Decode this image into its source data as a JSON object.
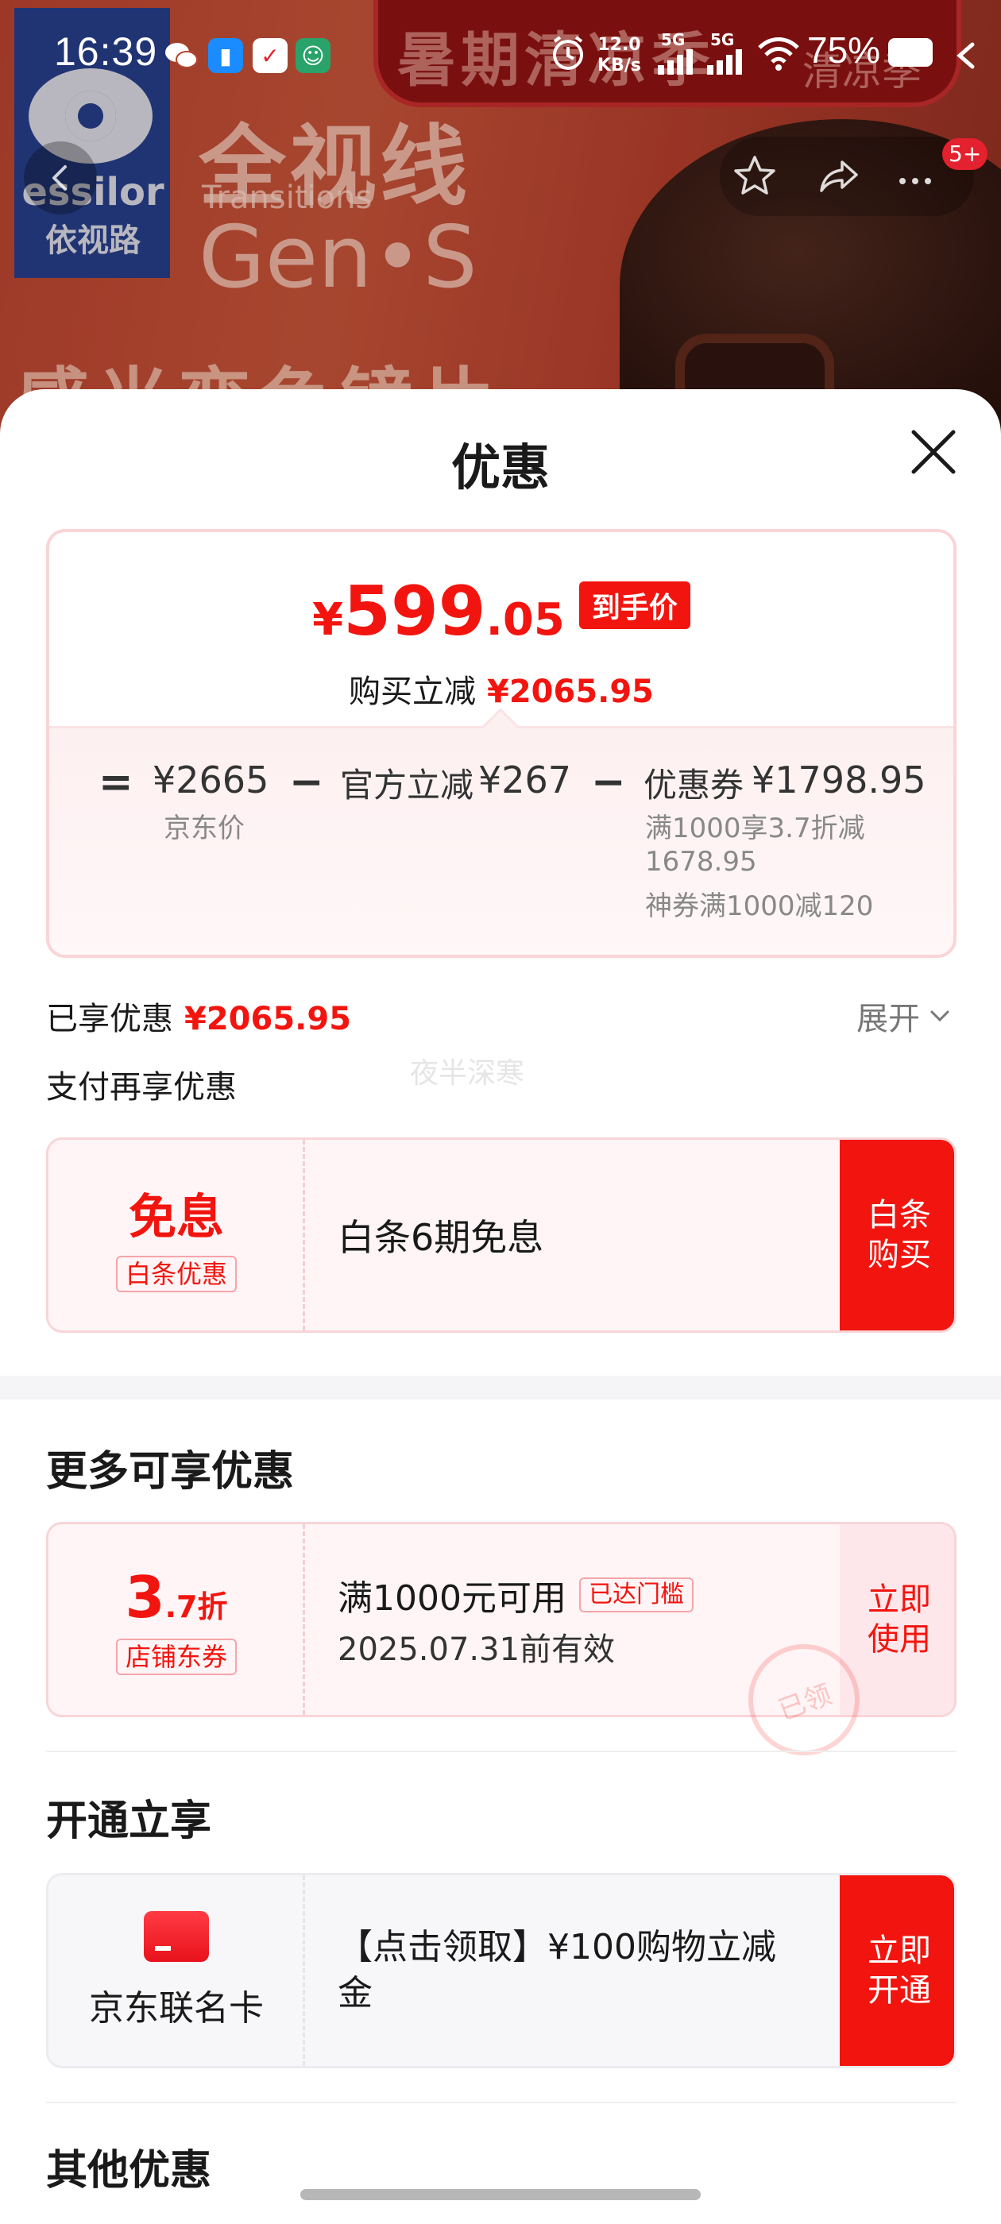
{
  "status_bar": {
    "time": "16:39",
    "net_speed_value": "12.0",
    "net_speed_unit": "KB/s",
    "signal_1": "5G",
    "signal_2": "5G",
    "battery": "75%"
  },
  "hero": {
    "brand_en": "essilor",
    "brand_cn": "依视路",
    "headline_cn": "全视线",
    "headline_en": "Transitions",
    "product_name": "Gen•S",
    "slogan": "感光变色镜片",
    "promo_banner": "暑期清凉季",
    "promo_badge": "清凉季",
    "nav_badge": "5+"
  },
  "sheet": {
    "title": "优惠"
  },
  "price_card": {
    "currency": "¥",
    "price_integer": "599",
    "price_decimal": ".05",
    "price_tag": "到手价",
    "saving_label": "购买立减",
    "saving_amount": "¥2065.95",
    "equals": "=",
    "minus": "−",
    "jd_price": "¥2665",
    "jd_price_label": "京东价",
    "official_label": "官方立减",
    "official_amount": "¥267",
    "coupon_label": "优惠券",
    "coupon_amount": "¥1798.95",
    "coupon_detail_1": "满1000享3.7折减",
    "coupon_detail_2": "1678.95",
    "coupon_detail_3": "神券满1000减120"
  },
  "summary": {
    "enjoyed_label": "已享优惠",
    "enjoyed_amount": "¥2065.95",
    "expand_label": "展开",
    "pay_more_label": "支付再享优惠",
    "watermark": "夜半深寒"
  },
  "baitiao_offer": {
    "big": "免息",
    "tag": "白条优惠",
    "title": "白条6期免息",
    "action": "白条购买"
  },
  "more_section": {
    "title": "更多可享优惠",
    "coupon": {
      "discount_int": "3",
      "discount_dec": ".7折",
      "tag": "店铺东券",
      "condition": "满1000元可用",
      "badge": "已达门槛",
      "validity": "2025.07.31前有效",
      "action": "立即使用",
      "stamp": "已领"
    }
  },
  "open_section": {
    "title": "开通立享",
    "card": {
      "name": "京东联名卡",
      "desc": "【点击领取】¥100购物立减金",
      "action": "立即开通"
    }
  },
  "other_section": {
    "title": "其他优惠"
  },
  "colors": {
    "accent_red": "#f2150f",
    "hero_red": "#b7432f",
    "brand_blue": "#1f3d8c"
  }
}
